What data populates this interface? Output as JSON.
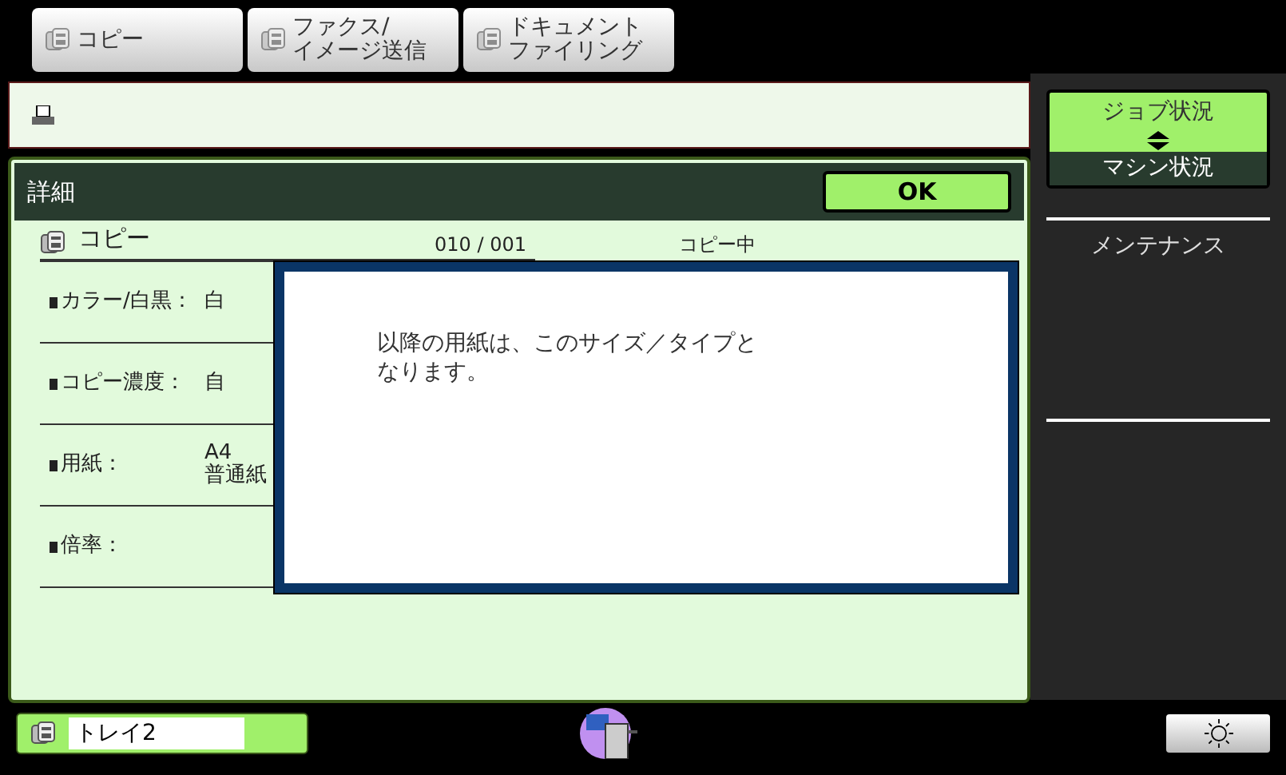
{
  "tabs": [
    {
      "lines": [
        "コピー"
      ]
    },
    {
      "lines": [
        "ファクス/",
        "イメージ送信"
      ]
    },
    {
      "lines": [
        "ドキュメント",
        "ファイリング"
      ]
    }
  ],
  "detail": {
    "title": "詳細",
    "ok": "OK",
    "job": {
      "name": "コピー",
      "count": "010 / 001",
      "status": "コピー中"
    },
    "rows": [
      {
        "label": "カラー/白黒：",
        "value": [
          "白"
        ]
      },
      {
        "label": "コピー濃度：",
        "value": [
          "自"
        ]
      },
      {
        "label": "用紙：",
        "value": [
          "A4",
          "普通紙"
        ]
      },
      {
        "label": "倍率：",
        "value": []
      }
    ]
  },
  "dialog": {
    "message": [
      "以降の用紙は、このサイズ／タイプと",
      "なります。"
    ]
  },
  "sidebar": {
    "status_top": "ジョブ状況",
    "status_bottom": "マシン状況",
    "items": [
      "メンテナンス"
    ]
  },
  "footer": {
    "tray": "トレイ2"
  }
}
